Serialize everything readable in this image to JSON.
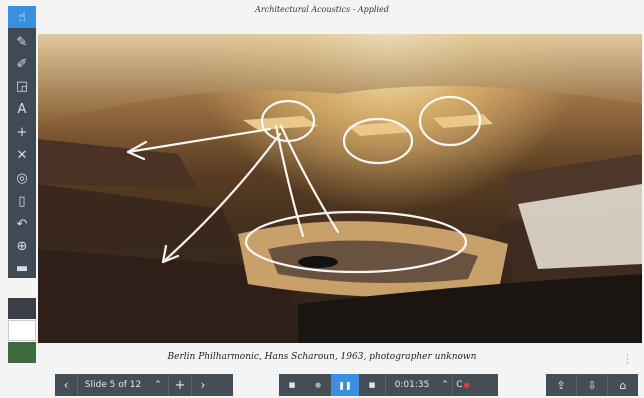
{
  "header": {
    "title": "Architectural Acoustics - Applied"
  },
  "toolbar": {
    "tools": [
      {
        "name": "hand",
        "glyph": "☝"
      },
      {
        "name": "pen",
        "glyph": "✎"
      },
      {
        "name": "highlighter",
        "glyph": "✐"
      },
      {
        "name": "shapes",
        "glyph": "◲"
      },
      {
        "name": "text",
        "glyph": "A"
      },
      {
        "name": "add",
        "glyph": "+"
      },
      {
        "name": "delete",
        "glyph": "✕"
      },
      {
        "name": "spotlight",
        "glyph": "◎"
      },
      {
        "name": "page",
        "glyph": "▯"
      },
      {
        "name": "undo",
        "glyph": "↶"
      },
      {
        "name": "zoom",
        "glyph": "⊕"
      },
      {
        "name": "screen",
        "glyph": "▬"
      }
    ],
    "colors": [
      "#3b4046",
      "#ffffff",
      "#3f6a3e"
    ]
  },
  "caption": "Berlin Philharmonic, Hans Scharoun, 1963, photographer unknown",
  "nav": {
    "prev_glyph": "‹",
    "slide_label": "Slide 5 of 12",
    "up_glyph": "⌃",
    "add_glyph": "+",
    "next_glyph": "›"
  },
  "playback": {
    "stop_glyph": "■",
    "dot_glyph": "●",
    "pause_glyph": "❚❚",
    "end_glyph": "■",
    "timer": "0:01:35",
    "up_glyph": "⌃",
    "record_label": "C"
  },
  "actions": {
    "share_glyph": "⇪",
    "export_glyph": "⇩",
    "home_glyph": "⌂"
  },
  "accent_color": "#3b8fe0",
  "record_color": "#e23b3b"
}
